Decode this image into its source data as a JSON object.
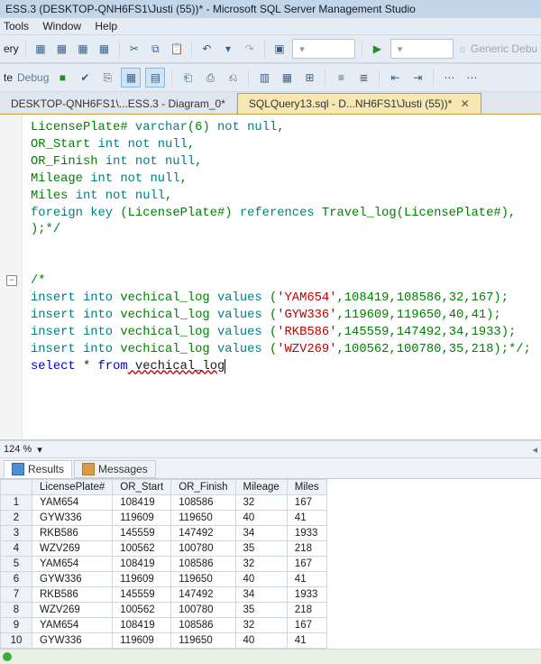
{
  "window": {
    "title": "ESS.3 (DESKTOP-QNH6FS1\\Justi (55))* - Microsoft SQL Server Management Studio"
  },
  "menu": {
    "tools": "Tools",
    "window": "Window",
    "help": "Help"
  },
  "toolbar1": {
    "left_label": "ery",
    "generic_debug": "Generic Debu"
  },
  "toolbar2": {
    "left_label": "te",
    "debug": "Debug"
  },
  "tabs": {
    "inactive": "DESKTOP-QNH6FS1\\...ESS.3 - Diagram_0*",
    "active": "SQLQuery13.sql - D...NH6FS1\\Justi (55))*"
  },
  "sql": {
    "l1a": "LicensePlate#",
    "l1b": " varchar",
    "l1c": "(",
    "l1d": "6",
    "l1e": ")",
    "l1f": " not null",
    "l2a": "OR_Start",
    "l2b": " int not null",
    "l3a": "OR_Finish",
    "l3b": " int not null",
    "l4a": "Mileage",
    "l4b": " int not null",
    "l5a": "Miles",
    "l5b": " int not null",
    "l6a": "foreign key ",
    "l6b": "(",
    "l6c": "LicensePlate#",
    "l6d": ")",
    "l6e": " references",
    "l6f": " Travel_log",
    "l6g": "(",
    "l6h": "LicensePlate#",
    "l6i": ")",
    "l7": ");*/",
    "c0": "/*",
    "i_ins": "insert into",
    "i_tbl": " vechical_log",
    "i_val": " values ",
    "lp": "(",
    "rp": ")",
    "semi": ";",
    "comma": ",",
    "r1s": "'YAM654'",
    "r1n1": "108419",
    "r1n2": "108586",
    "r1n3": "32",
    "r1n4": "167",
    "r2s": "'GYW336'",
    "r2n1": "119609",
    "r2n2": "119650",
    "r2n3": "40",
    "r2n4": "41",
    "r3s": "'RKB586'",
    "r3n1": "145559",
    "r3n2": "147492",
    "r3n3": "34",
    "r3n4": "1933",
    "r4s": "'WZV269'",
    "r4n1": "100562",
    "r4n2": "100780",
    "r4n3": "35",
    "r4n4": "218",
    "r4tail": "*/;",
    "sel_a": "select",
    "sel_b": " * ",
    "sel_c": "from",
    "sel_d": " vechical_log"
  },
  "zoom": {
    "value": "124 %"
  },
  "panes": {
    "results": "Results",
    "messages": "Messages"
  },
  "headers": [
    "LicensePlate#",
    "OR_Start",
    "OR_Finish",
    "Mileage",
    "Miles"
  ],
  "rows": [
    [
      "1",
      "YAM654",
      "108419",
      "108586",
      "32",
      "167"
    ],
    [
      "2",
      "GYW336",
      "119609",
      "119650",
      "40",
      "41"
    ],
    [
      "3",
      "RKB586",
      "145559",
      "147492",
      "34",
      "1933"
    ],
    [
      "4",
      "WZV269",
      "100562",
      "100780",
      "35",
      "218"
    ],
    [
      "5",
      "YAM654",
      "108419",
      "108586",
      "32",
      "167"
    ],
    [
      "6",
      "GYW336",
      "119609",
      "119650",
      "40",
      "41"
    ],
    [
      "7",
      "RKB586",
      "145559",
      "147492",
      "34",
      "1933"
    ],
    [
      "8",
      "WZV269",
      "100562",
      "100780",
      "35",
      "218"
    ],
    [
      "9",
      "YAM654",
      "108419",
      "108586",
      "32",
      "167"
    ],
    [
      "10",
      "GYW336",
      "119609",
      "119650",
      "40",
      "41"
    ]
  ]
}
